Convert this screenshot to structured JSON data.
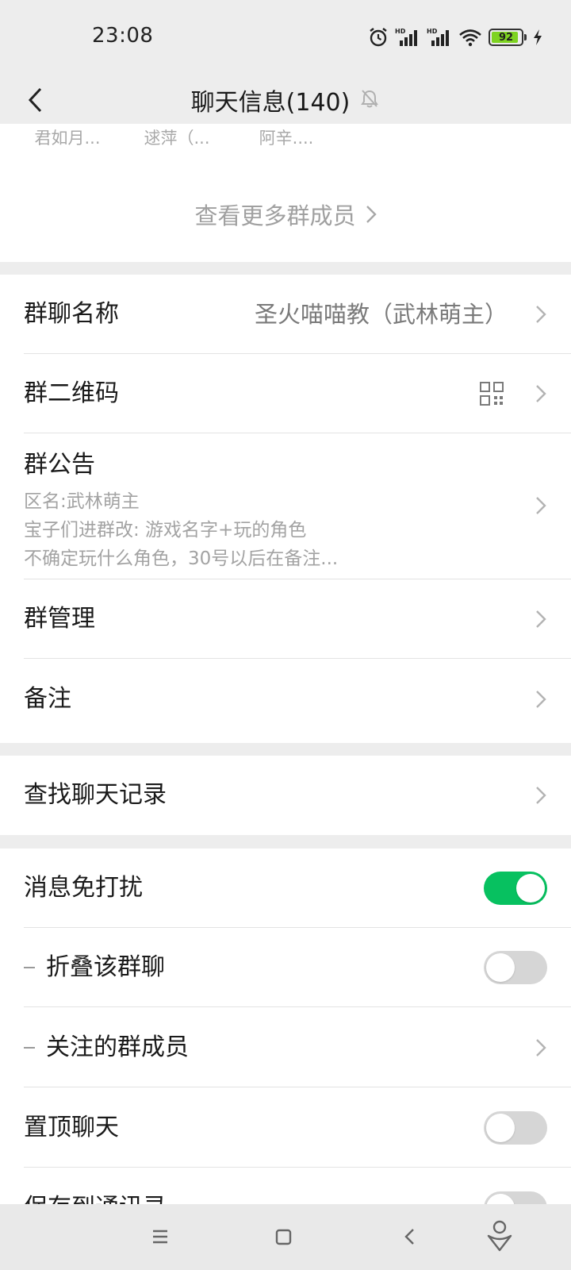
{
  "status_bar": {
    "time": "23:08",
    "battery_level": "92",
    "battery_percent": 92,
    "battery_color": "#7ed321",
    "icons": [
      "alarm-icon",
      "signal-hd-1-icon",
      "signal-hd-2-icon",
      "wifi-icon",
      "battery-icon",
      "charging-icon"
    ]
  },
  "header": {
    "title": "聊天信息(140)",
    "back_icon": "back-chevron-icon",
    "mute_icon": "bell-muted-icon"
  },
  "members": {
    "names": [
      "君如月...",
      "逑萍（...",
      "阿辛...."
    ],
    "more_label": "查看更多群成员"
  },
  "group_info": {
    "group_name_label": "群聊名称",
    "group_name_value": "圣火喵喵教（武林萌主）",
    "qr_label": "群二维码",
    "announcement_label": "群公告",
    "announcement_lines": [
      "区名:武林萌主",
      "宝子们进群改: 游戏名字+玩的角色",
      "不确定玩什么角色，30号以后在备注..."
    ],
    "manage_label": "群管理",
    "remark_label": "备注"
  },
  "search": {
    "label": "查找聊天记录"
  },
  "settings": {
    "dnd_label": "消息免打扰",
    "dnd_on": true,
    "fold_label": "折叠该群聊",
    "fold_on": false,
    "followed_label": "关注的群成员",
    "pin_label": "置顶聊天",
    "pin_on": false,
    "save_label": "保存到通讯录",
    "save_on": false,
    "accent_color": "#07c160"
  },
  "system_nav": {
    "icons": [
      "menu-icon",
      "home-square-icon",
      "back-triangle-icon",
      "assistant-icon"
    ]
  }
}
